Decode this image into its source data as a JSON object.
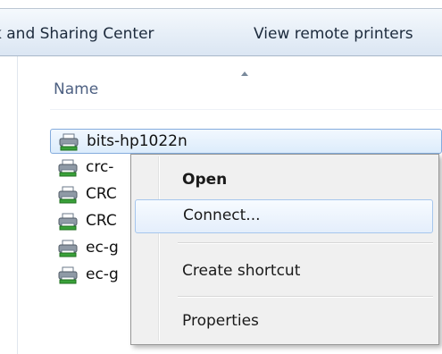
{
  "toolbar": {
    "items": [
      {
        "label": "k and Sharing Center"
      },
      {
        "label": "View remote printers"
      }
    ]
  },
  "list": {
    "column_header": "Name",
    "rows": [
      {
        "label": "bits-hp1022n",
        "icon": "printer-icon",
        "selected": true
      },
      {
        "label": "crc-",
        "icon": "printer-icon"
      },
      {
        "label": "CRC",
        "icon": "printer-icon"
      },
      {
        "label": "CRC",
        "icon": "printer-icon"
      },
      {
        "label": "ec-g",
        "icon": "printer-icon"
      },
      {
        "label": "ec-g",
        "icon": "printer-icon"
      }
    ]
  },
  "context_menu": {
    "items": [
      {
        "label": "Open",
        "bold": true
      },
      {
        "label": "Connect...",
        "hover": true
      },
      {
        "label": "Create shortcut"
      },
      {
        "label": "Properties"
      }
    ]
  },
  "colors": {
    "selection_border": "#84acdd",
    "menu_background": "#f0f0f0",
    "header_text": "#4d6082"
  }
}
